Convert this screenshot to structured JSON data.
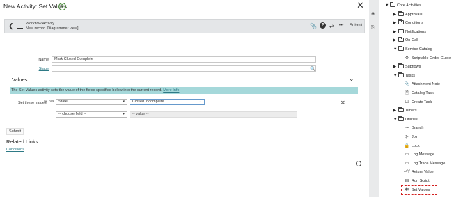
{
  "modal": {
    "title": "New Activity: Set Values",
    "help_icon": "?",
    "close_icon": "✕"
  },
  "workflow_bar": {
    "back_icon": "❮",
    "title": "Workflow Activity",
    "subtitle": "New record [Diagrammer view]",
    "attachment_icon": "📎",
    "help_icon": "?",
    "settings_icon": "⇌",
    "more_icon": "•••",
    "submit_label": "Submit"
  },
  "form": {
    "name_label": "Name",
    "name_value": "Mark Closed Complete",
    "stage_label": "Stage",
    "stage_value": "",
    "search_icon": "🔍"
  },
  "values_section": {
    "header": "Values",
    "collapse_icon": "⌄",
    "info_text": "The Set Values activity sets the value of the fields specified below into the current record.",
    "info_link": "More Info",
    "row1": {
      "label": "Set these values",
      "icon": "▤ n/a",
      "field": "State",
      "value": "Closed Incomplete",
      "remove_icon": "✕"
    },
    "row2": {
      "field_placeholder": "-- choose field --",
      "value_placeholder": "-- value --"
    }
  },
  "footer": {
    "submit_label": "Submit",
    "related_links_title": "Related Links",
    "conditions_link": "Conditions"
  },
  "sidebar": {
    "root": "Core Activities",
    "items": [
      {
        "label": "Approvals",
        "type": "folder",
        "expanded": false,
        "level": 1
      },
      {
        "label": "Conditions",
        "type": "folder",
        "expanded": false,
        "level": 1
      },
      {
        "label": "Notifications",
        "type": "folder",
        "expanded": false,
        "level": 1
      },
      {
        "label": "On-Call",
        "type": "folder",
        "expanded": false,
        "level": 1
      },
      {
        "label": "Service Catalog",
        "type": "folder",
        "expanded": true,
        "level": 1
      },
      {
        "label": "Scriptable Order Guide",
        "type": "activity",
        "icon": "⚙",
        "level": 2
      },
      {
        "label": "Subflows",
        "type": "folder",
        "expanded": false,
        "level": 1
      },
      {
        "label": "Tasks",
        "type": "folder",
        "expanded": true,
        "level": 1
      },
      {
        "label": "Attachment Note",
        "type": "activity",
        "icon": "📎",
        "level": 2
      },
      {
        "label": "Catalog Task",
        "type": "activity",
        "icon": "🗎",
        "level": 2
      },
      {
        "label": "Create Task",
        "type": "activity",
        "icon": "☑",
        "level": 2
      },
      {
        "label": "Timers",
        "type": "folder",
        "expanded": false,
        "level": 1
      },
      {
        "label": "Utilities",
        "type": "folder",
        "expanded": true,
        "level": 1
      },
      {
        "label": "Branch",
        "type": "activity",
        "icon": "⊸",
        "level": 2
      },
      {
        "label": "Join",
        "type": "activity",
        "icon": "⊱",
        "level": 2
      },
      {
        "label": "Lock",
        "type": "activity",
        "icon": "🔒",
        "level": 2
      },
      {
        "label": "Log Message",
        "type": "activity",
        "icon": "▭",
        "level": 2
      },
      {
        "label": "Log Trace Message",
        "type": "activity",
        "icon": "▭",
        "level": 2
      },
      {
        "label": "Return Value",
        "type": "activity",
        "icon": "↵Y",
        "level": 2
      },
      {
        "label": "Run Script",
        "type": "activity",
        "icon": "▤",
        "level": 2
      },
      {
        "label": "Set Values",
        "type": "activity",
        "icon": "X=",
        "level": 2
      }
    ]
  },
  "colors": {
    "info_bar": "#a5d8da",
    "highlight_border": "#d32020",
    "link": "#2e7a86"
  }
}
